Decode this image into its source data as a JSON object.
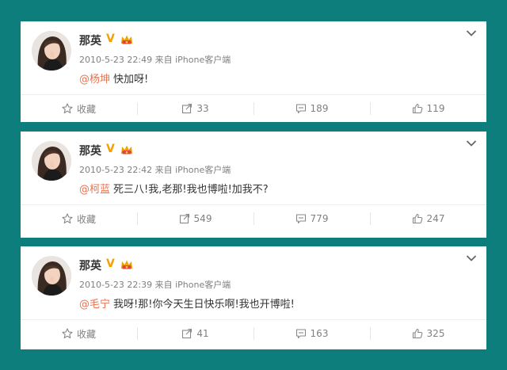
{
  "posts": [
    {
      "author": "那英",
      "vip_mark": "V",
      "timestamp": "2010-5-23 22:49",
      "source": "来自 iPhone客户端",
      "mention": "@杨坤",
      "text": "快加呀!",
      "favorite_label": "收藏",
      "reposts": "33",
      "comments": "189",
      "likes": "119"
    },
    {
      "author": "那英",
      "vip_mark": "V",
      "timestamp": "2010-5-23 22:42",
      "source": "来自 iPhone客户端",
      "mention": "@柯蓝",
      "text": "死三八!我,老那!我也博啦!加我不?",
      "favorite_label": "收藏",
      "reposts": "549",
      "comments": "779",
      "likes": "247"
    },
    {
      "author": "那英",
      "vip_mark": "V",
      "timestamp": "2010-5-23 22:39",
      "source": "来自 iPhone客户端",
      "mention": "@毛宁",
      "text": "我呀!那!你今天生日快乐啊!我也开博啦!",
      "favorite_label": "收藏",
      "reposts": "41",
      "comments": "163",
      "likes": "325"
    }
  ],
  "colors": {
    "background": "#0d7e7c",
    "mention": "#eb7350",
    "vip": "#f4a000",
    "meta_text": "#808080"
  },
  "icons": [
    "avatar",
    "vip-v-icon",
    "crown-badge-icon",
    "chevron-down-icon",
    "star-icon",
    "repost-icon",
    "comment-icon",
    "thumbs-up-icon"
  ]
}
